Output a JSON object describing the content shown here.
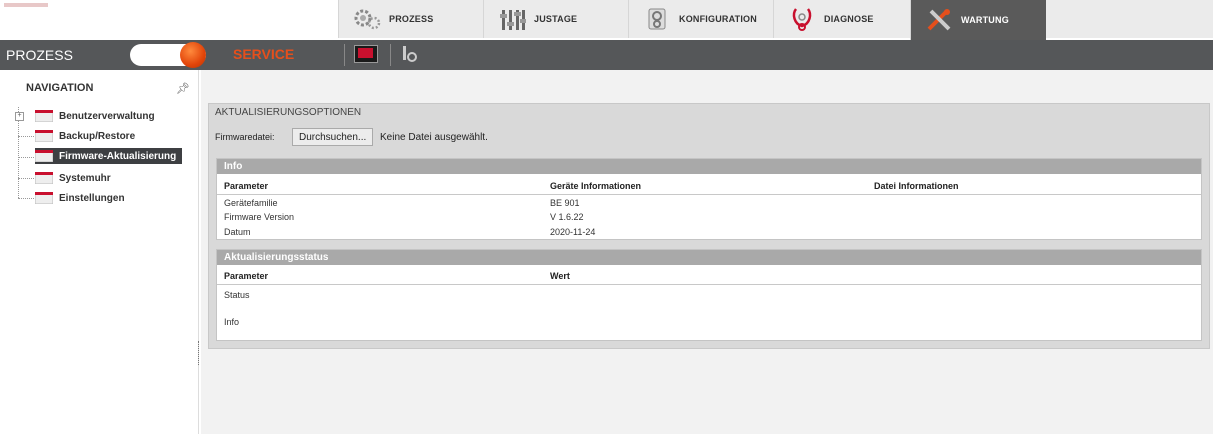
{
  "tabs": [
    {
      "label": "PROZESS",
      "icon": "gears-icon"
    },
    {
      "label": "JUSTAGE",
      "icon": "sliders-icon"
    },
    {
      "label": "KONFIGURATION",
      "icon": "config-icon"
    },
    {
      "label": "DIAGNOSE",
      "icon": "stethoscope-icon"
    },
    {
      "label": "WARTUNG",
      "icon": "tools-icon",
      "active": true
    }
  ],
  "modebar": {
    "left_label": "PROZESS",
    "right_label": "SERVICE",
    "accent": "#e54f1c"
  },
  "navigation": {
    "title": "NAVIGATION",
    "items": [
      {
        "label": "Benutzerverwaltung",
        "expandable": true
      },
      {
        "label": "Backup/Restore"
      },
      {
        "label": "Firmware-Aktualisierung",
        "active": true
      },
      {
        "label": "Systemuhr"
      },
      {
        "label": "Einstellungen"
      }
    ]
  },
  "main": {
    "panel_title": "AKTUALISIERUNGSOPTIONEN",
    "firmware_label": "Firmwaredatei:",
    "browse_button": "Durchsuchen...",
    "no_file_text": "Keine Datei ausgewählt.",
    "info": {
      "title": "Info",
      "headers": [
        "Parameter",
        "Geräte Informationen",
        "Datei Informationen"
      ],
      "rows": [
        [
          "Gerätefamilie",
          "BE 901",
          ""
        ],
        [
          "Firmware Version",
          "V 1.6.22",
          ""
        ],
        [
          "Datum",
          "2020-11-24",
          ""
        ]
      ]
    },
    "status": {
      "title": "Aktualisierungsstatus",
      "headers": [
        "Parameter",
        "Wert"
      ],
      "rows": [
        [
          "Status",
          ""
        ],
        [
          "Info",
          ""
        ]
      ]
    }
  }
}
